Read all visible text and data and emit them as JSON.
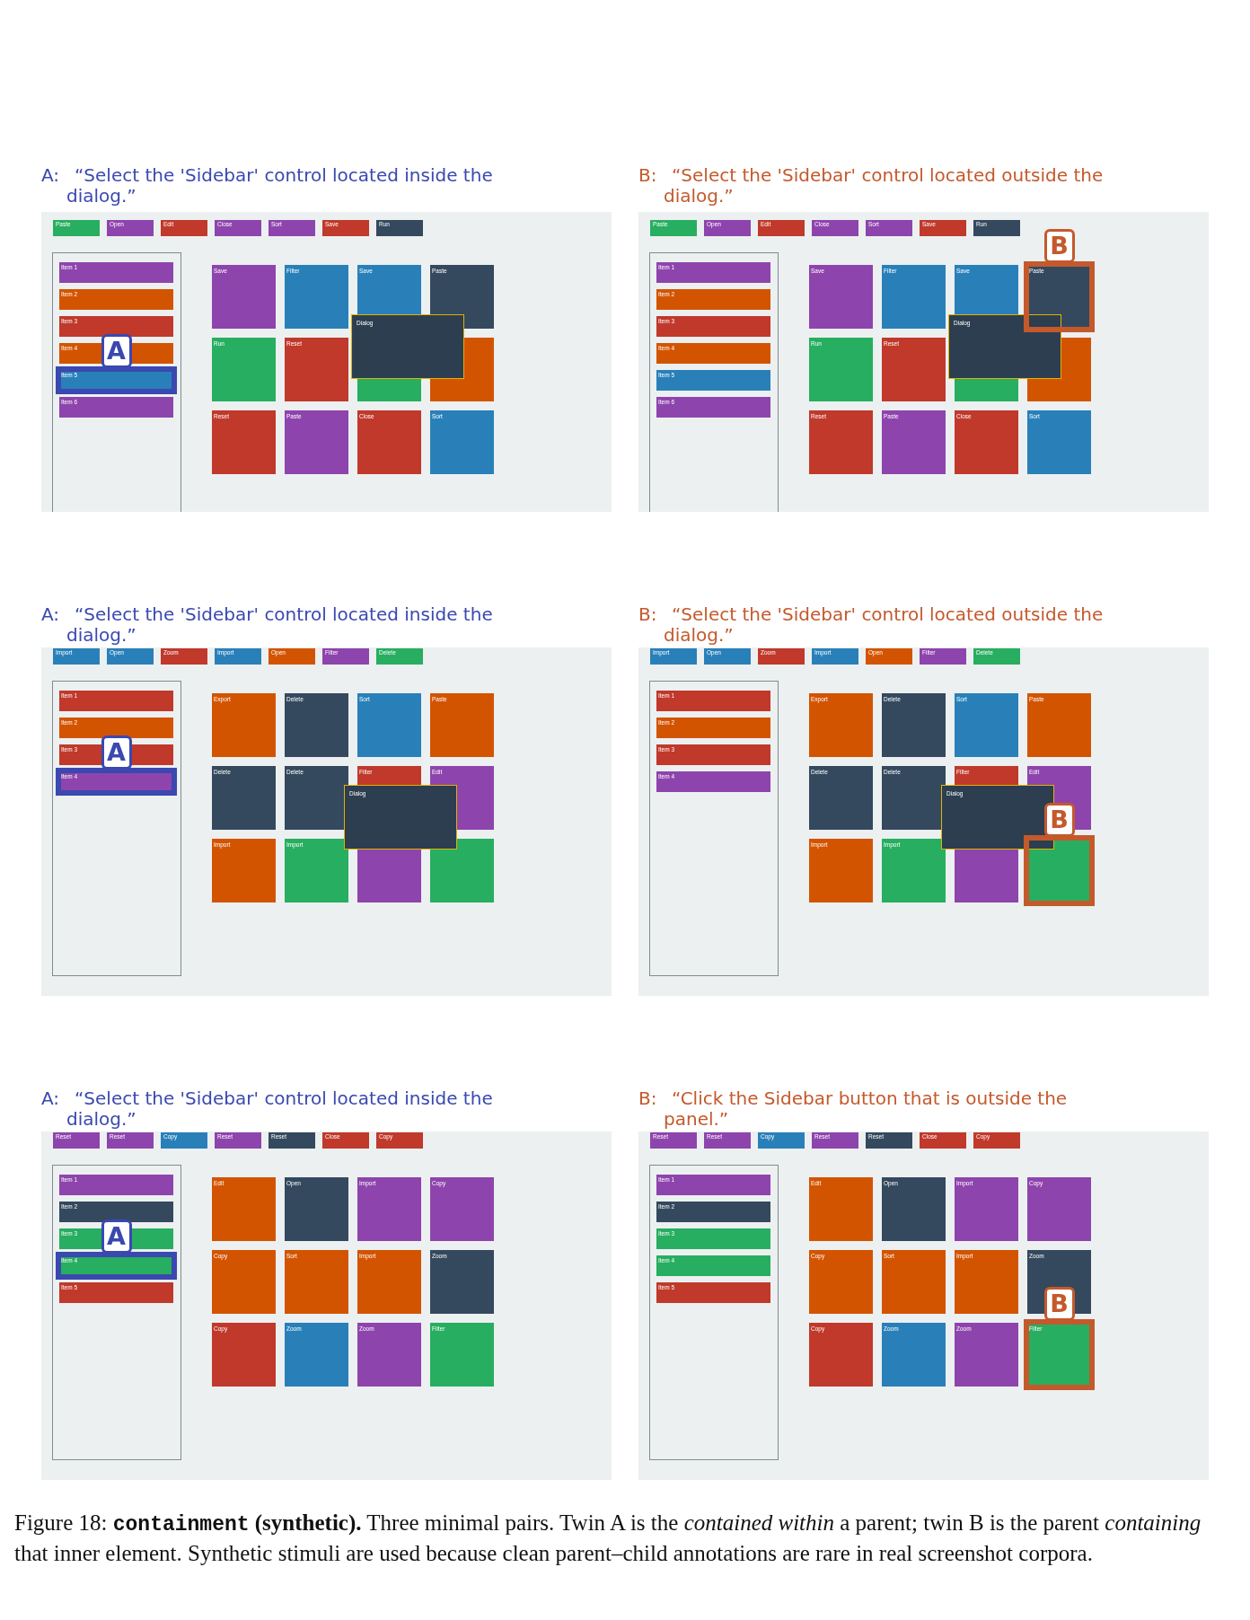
{
  "figure": {
    "rows": [
      {
        "panels": [
          {
            "color": "#3a48b0",
            "label": "A:",
            "instruction": "“Select the 'Sidebar' control located inside the dialog.”",
            "marker": "A",
            "toolbar": [
              {
                "label": "Paste",
                "color": "#27ae60"
              },
              {
                "label": "Open",
                "color": "#8e44ad"
              },
              {
                "label": "Edit",
                "color": "#c0392b"
              },
              {
                "label": "Close",
                "color": "#8e44ad"
              },
              {
                "label": "Sort",
                "color": "#8e44ad"
              },
              {
                "label": "Save",
                "color": "#c0392b"
              },
              {
                "label": "Run",
                "color": "#34495e"
              }
            ],
            "sidebar": [
              {
                "label": "Item 1",
                "color": "#8e44ad",
                "highlighted": false
              },
              {
                "label": "Item 2",
                "color": "#d35400",
                "highlighted": false
              },
              {
                "label": "Item 3",
                "color": "#c0392b",
                "highlighted": false
              },
              {
                "label": "Item 4",
                "color": "#d35400",
                "highlighted": false
              },
              {
                "label": "Item 5",
                "color": "#2980b9",
                "highlighted": true
              },
              {
                "label": "Item 6",
                "color": "#8e44ad",
                "highlighted": false
              }
            ],
            "tiles": [
              {
                "label": "Save",
                "color": "#8e44ad",
                "highlighted": false
              },
              {
                "label": "Filter",
                "color": "#2980b9",
                "highlighted": false
              },
              {
                "label": "Save",
                "color": "#2980b9",
                "highlighted": false
              },
              {
                "label": "Paste",
                "color": "#34495e",
                "highlighted": false
              },
              {
                "label": "Run",
                "color": "#27ae60",
                "highlighted": false
              },
              {
                "label": "Reset",
                "color": "#c0392b",
                "highlighted": false
              },
              {
                "color": "#27ae60",
                "highlighted": false
              },
              {
                "color": "#d35400",
                "highlighted": false
              },
              {
                "label": "Reset",
                "color": "#c0392b",
                "highlighted": false
              },
              {
                "label": "Paste",
                "color": "#8e44ad",
                "highlighted": false
              },
              {
                "label": "Close",
                "color": "#c0392b",
                "highlighted": false
              },
              {
                "label": "Sort",
                "color": "#2980b9",
                "highlighted": false
              }
            ],
            "dialog": {
              "label": "Dialog"
            }
          },
          {
            "color": "#c4592c",
            "label": "B:",
            "instruction": "“Select the 'Sidebar' control located outside the dialog.”",
            "marker": "B",
            "toolbar": [
              {
                "label": "Paste",
                "color": "#27ae60"
              },
              {
                "label": "Open",
                "color": "#8e44ad"
              },
              {
                "label": "Edit",
                "color": "#c0392b"
              },
              {
                "label": "Close",
                "color": "#8e44ad"
              },
              {
                "label": "Sort",
                "color": "#8e44ad"
              },
              {
                "label": "Save",
                "color": "#c0392b"
              },
              {
                "label": "Run",
                "color": "#34495e"
              }
            ],
            "sidebar": [
              {
                "label": "Item 1",
                "color": "#8e44ad",
                "highlighted": false
              },
              {
                "label": "Item 2",
                "color": "#d35400",
                "highlighted": false
              },
              {
                "label": "Item 3",
                "color": "#c0392b",
                "highlighted": false
              },
              {
                "label": "Item 4",
                "color": "#d35400",
                "highlighted": false
              },
              {
                "label": "Item 5",
                "color": "#2980b9",
                "highlighted": false
              },
              {
                "label": "Item 6",
                "color": "#8e44ad",
                "highlighted": false
              }
            ],
            "tiles": [
              {
                "label": "Save",
                "color": "#8e44ad",
                "highlighted": false
              },
              {
                "label": "Filter",
                "color": "#2980b9",
                "highlighted": false
              },
              {
                "label": "Save",
                "color": "#2980b9",
                "highlighted": false
              },
              {
                "label": "Paste",
                "color": "#34495e",
                "highlighted": true
              },
              {
                "label": "Run",
                "color": "#27ae60",
                "highlighted": false
              },
              {
                "label": "Reset",
                "color": "#c0392b",
                "highlighted": false
              },
              {
                "color": "#27ae60",
                "highlighted": false
              },
              {
                "color": "#d35400",
                "highlighted": false
              },
              {
                "label": "Reset",
                "color": "#c0392b",
                "highlighted": false
              },
              {
                "label": "Paste",
                "color": "#8e44ad",
                "highlighted": false
              },
              {
                "label": "Close",
                "color": "#c0392b",
                "highlighted": false
              },
              {
                "label": "Sort",
                "color": "#2980b9",
                "highlighted": false
              }
            ],
            "dialog": {
              "label": "Dialog"
            }
          }
        ]
      },
      {
        "panels": [
          {
            "color": "#3a48b0",
            "label": "A:",
            "instruction": "“Select the 'Sidebar' control located inside the dialog.”",
            "marker": "A",
            "toolbar": [
              {
                "label": "Import",
                "color": "#2980b9"
              },
              {
                "label": "Open",
                "color": "#2980b9"
              },
              {
                "label": "Zoom",
                "color": "#c0392b"
              },
              {
                "label": "Import",
                "color": "#2980b9"
              },
              {
                "label": "Open",
                "color": "#d35400"
              },
              {
                "label": "Filter",
                "color": "#8e44ad"
              },
              {
                "label": "Delete",
                "color": "#27ae60"
              }
            ],
            "sidebar": [
              {
                "label": "Item 1",
                "color": "#c0392b",
                "highlighted": false
              },
              {
                "label": "Item 2",
                "color": "#d35400",
                "highlighted": false
              },
              {
                "label": "Item 3",
                "color": "#c0392b",
                "highlighted": false
              },
              {
                "label": "Item 4",
                "color": "#8e44ad",
                "highlighted": true
              }
            ],
            "tiles": [
              {
                "label": "Export",
                "color": "#d35400",
                "highlighted": false
              },
              {
                "label": "Delete",
                "color": "#34495e",
                "highlighted": false
              },
              {
                "label": "Sort",
                "color": "#2980b9",
                "highlighted": false
              },
              {
                "label": "Paste",
                "color": "#d35400",
                "highlighted": false
              },
              {
                "label": "Delete",
                "color": "#34495e",
                "highlighted": false
              },
              {
                "label": "Delete",
                "color": "#34495e",
                "highlighted": false
              },
              {
                "label": "Filter",
                "color": "#c0392b",
                "highlighted": false
              },
              {
                "label": "Edit",
                "color": "#8e44ad",
                "highlighted": false
              },
              {
                "label": "Import",
                "color": "#d35400",
                "highlighted": false
              },
              {
                "label": "Import",
                "color": "#27ae60",
                "highlighted": false
              },
              {
                "color": "#8e44ad",
                "highlighted": false
              },
              {
                "color": "#27ae60",
                "highlighted": false
              }
            ],
            "dialog": {
              "label": "Dialog"
            }
          },
          {
            "color": "#c4592c",
            "label": "B:",
            "instruction": "“Select the 'Sidebar' control located outside the dialog.”",
            "marker": "B",
            "toolbar": [
              {
                "label": "Import",
                "color": "#2980b9"
              },
              {
                "label": "Open",
                "color": "#2980b9"
              },
              {
                "label": "Zoom",
                "color": "#c0392b"
              },
              {
                "label": "Import",
                "color": "#2980b9"
              },
              {
                "label": "Open",
                "color": "#d35400"
              },
              {
                "label": "Filter",
                "color": "#8e44ad"
              },
              {
                "label": "Delete",
                "color": "#27ae60"
              }
            ],
            "sidebar": [
              {
                "label": "Item 1",
                "color": "#c0392b",
                "highlighted": false
              },
              {
                "label": "Item 2",
                "color": "#d35400",
                "highlighted": false
              },
              {
                "label": "Item 3",
                "color": "#c0392b",
                "highlighted": false
              },
              {
                "label": "Item 4",
                "color": "#8e44ad",
                "highlighted": false
              }
            ],
            "tiles": [
              {
                "label": "Export",
                "color": "#d35400",
                "highlighted": false
              },
              {
                "label": "Delete",
                "color": "#34495e",
                "highlighted": false
              },
              {
                "label": "Sort",
                "color": "#2980b9",
                "highlighted": false
              },
              {
                "label": "Paste",
                "color": "#d35400",
                "highlighted": false
              },
              {
                "label": "Delete",
                "color": "#34495e",
                "highlighted": false
              },
              {
                "label": "Delete",
                "color": "#34495e",
                "highlighted": false
              },
              {
                "label": "Filter",
                "color": "#c0392b",
                "highlighted": false
              },
              {
                "label": "Edit",
                "color": "#8e44ad",
                "highlighted": false
              },
              {
                "label": "Import",
                "color": "#d35400",
                "highlighted": false
              },
              {
                "label": "Import",
                "color": "#27ae60",
                "highlighted": false
              },
              {
                "color": "#8e44ad",
                "highlighted": false
              },
              {
                "color": "#27ae60",
                "highlighted": true
              }
            ],
            "dialog": {
              "label": "Dialog"
            }
          }
        ]
      },
      {
        "panels": [
          {
            "color": "#3a48b0",
            "label": "A:",
            "instruction": "“Select the 'Sidebar' control located inside the dialog.”",
            "marker": "A",
            "toolbar": [
              {
                "label": "Reset",
                "color": "#8e44ad"
              },
              {
                "label": "Reset",
                "color": "#8e44ad"
              },
              {
                "label": "Copy",
                "color": "#2980b9"
              },
              {
                "label": "Reset",
                "color": "#8e44ad"
              },
              {
                "label": "Reset",
                "color": "#34495e"
              },
              {
                "label": "Close",
                "color": "#c0392b"
              },
              {
                "label": "Copy",
                "color": "#c0392b"
              }
            ],
            "sidebar": [
              {
                "label": "Item 1",
                "color": "#8e44ad",
                "highlighted": false
              },
              {
                "label": "Item 2",
                "color": "#34495e",
                "highlighted": false
              },
              {
                "label": "Item 3",
                "color": "#27ae60",
                "highlighted": false
              },
              {
                "label": "Item 4",
                "color": "#27ae60",
                "highlighted": true
              },
              {
                "label": "Item 5",
                "color": "#c0392b",
                "highlighted": false
              }
            ],
            "tiles": [
              {
                "label": "Edit",
                "color": "#d35400",
                "highlighted": false
              },
              {
                "label": "Open",
                "color": "#34495e",
                "highlighted": false
              },
              {
                "label": "Import",
                "color": "#8e44ad",
                "highlighted": false
              },
              {
                "label": "Copy",
                "color": "#8e44ad",
                "highlighted": false
              },
              {
                "label": "Copy",
                "color": "#d35400",
                "highlighted": false
              },
              {
                "label": "Sort",
                "color": "#d35400",
                "highlighted": false
              },
              {
                "label": "Import",
                "color": "#d35400",
                "highlighted": false
              },
              {
                "label": "Zoom",
                "color": "#34495e",
                "highlighted": false
              },
              {
                "label": "Copy",
                "color": "#c0392b",
                "highlighted": false
              },
              {
                "label": "Zoom",
                "color": "#2980b9",
                "highlighted": false
              },
              {
                "label": "Zoom",
                "color": "#8e44ad",
                "highlighted": false
              },
              {
                "label": "Filter",
                "color": "#27ae60",
                "highlighted": false
              }
            ]
          },
          {
            "color": "#c4592c",
            "label": "B:",
            "instruction": "“Click the Sidebar button that is outside the panel.”",
            "marker": "B",
            "toolbar": [
              {
                "label": "Reset",
                "color": "#8e44ad"
              },
              {
                "label": "Reset",
                "color": "#8e44ad"
              },
              {
                "label": "Copy",
                "color": "#2980b9"
              },
              {
                "label": "Reset",
                "color": "#8e44ad"
              },
              {
                "label": "Reset",
                "color": "#34495e"
              },
              {
                "label": "Close",
                "color": "#c0392b"
              },
              {
                "label": "Copy",
                "color": "#c0392b"
              }
            ],
            "sidebar": [
              {
                "label": "Item 1",
                "color": "#8e44ad",
                "highlighted": false
              },
              {
                "label": "Item 2",
                "color": "#34495e",
                "highlighted": false
              },
              {
                "label": "Item 3",
                "color": "#27ae60",
                "highlighted": false
              },
              {
                "label": "Item 4",
                "color": "#27ae60",
                "highlighted": false
              },
              {
                "label": "Item 5",
                "color": "#c0392b",
                "highlighted": false
              }
            ],
            "tiles": [
              {
                "label": "Edit",
                "color": "#d35400",
                "highlighted": false
              },
              {
                "label": "Open",
                "color": "#34495e",
                "highlighted": false
              },
              {
                "label": "Import",
                "color": "#8e44ad",
                "highlighted": false
              },
              {
                "label": "Copy",
                "color": "#8e44ad",
                "highlighted": false
              },
              {
                "label": "Copy",
                "color": "#d35400",
                "highlighted": false
              },
              {
                "label": "Sort",
                "color": "#d35400",
                "highlighted": false
              },
              {
                "label": "Import",
                "color": "#d35400",
                "highlighted": false
              },
              {
                "label": "Zoom",
                "color": "#34495e",
                "highlighted": false
              },
              {
                "label": "Copy",
                "color": "#c0392b",
                "highlighted": false
              },
              {
                "label": "Zoom",
                "color": "#2980b9",
                "highlighted": false
              },
              {
                "label": "Zoom",
                "color": "#8e44ad",
                "highlighted": false
              },
              {
                "label": "Filter",
                "color": "#27ae60",
                "highlighted": true
              }
            ]
          }
        ]
      }
    ],
    "caption": {
      "label": "Figure 18:",
      "term": "containment",
      "text": "**(synthetic).** Three minimal pairs. Twin A is the *contained within* a parent; twin B is the parent *containing* that inner element. Synthetic stimuli are used because clean parent–child annotations are rare in real screenshot corpora."
    }
  }
}
